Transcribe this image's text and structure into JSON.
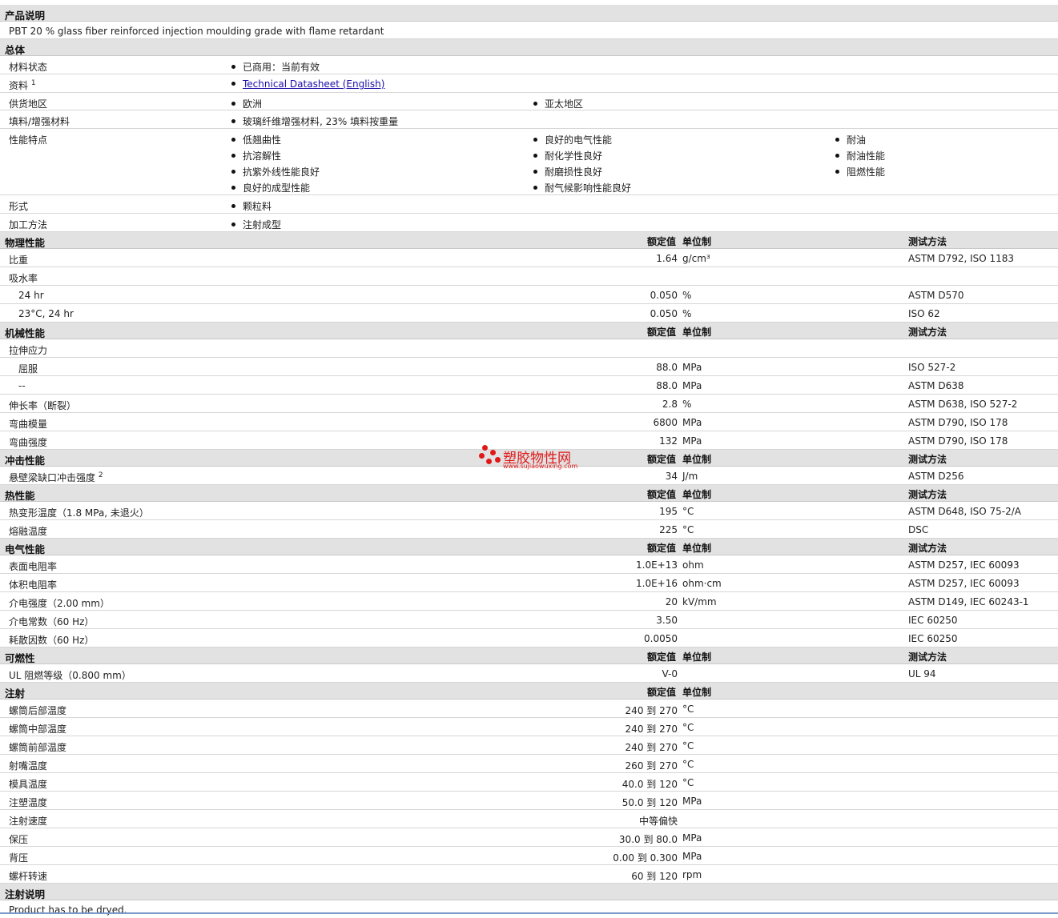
{
  "product": {
    "header": "产品说明",
    "description": "PBT 20 % glass fiber reinforced injection moulding grade with flame retardant"
  },
  "general": {
    "header": "总体",
    "rows": {
      "status": {
        "label": "材料状态",
        "items": [
          "已商用：当前有效"
        ]
      },
      "docs": {
        "label": "资料",
        "sup": "1",
        "link": "Technical Datasheet (English)"
      },
      "supply": {
        "label": "供货地区",
        "items": [
          "欧洲",
          "亚太地区"
        ]
      },
      "filler": {
        "label": "填料/增强材料",
        "items": [
          "玻璃纤维增强材料, 23% 填料按重量"
        ]
      },
      "features": {
        "label": "性能特点",
        "col1": [
          "低翘曲性",
          "抗溶解性",
          "抗紫外线性能良好",
          "良好的成型性能"
        ],
        "col2": [
          "良好的电气性能",
          "耐化学性良好",
          "耐磨损性良好",
          "耐气候影响性能良好"
        ],
        "col3": [
          "耐油",
          "耐油性能",
          "阻燃性能"
        ]
      },
      "form": {
        "label": "形式",
        "items": [
          "颗粒料"
        ]
      },
      "process": {
        "label": "加工方法",
        "items": [
          "注射成型"
        ]
      }
    }
  },
  "columns": {
    "value": "额定值",
    "unit": "单位制",
    "method": "测试方法"
  },
  "physical": {
    "header": "物理性能",
    "rows": [
      {
        "label": "比重",
        "value": "1.64",
        "unit": "g/cm³",
        "method": "ASTM D792, ISO 1183"
      },
      {
        "label": "吸水率",
        "value": "",
        "unit": "",
        "method": ""
      },
      {
        "label": "24 hr",
        "value": "0.050",
        "unit": "%",
        "method": "ASTM D570",
        "sub": true
      },
      {
        "label": "23°C, 24 hr",
        "value": "0.050",
        "unit": "%",
        "method": "ISO 62",
        "sub": true
      }
    ]
  },
  "mechanical": {
    "header": "机械性能",
    "rows": [
      {
        "label": "拉伸应力",
        "value": "",
        "unit": "",
        "method": ""
      },
      {
        "label": "屈服",
        "value": "88.0",
        "unit": "MPa",
        "method": "ISO 527-2",
        "sub": true
      },
      {
        "label": "--",
        "value": "88.0",
        "unit": "MPa",
        "method": "ASTM D638",
        "sub": true
      },
      {
        "label": "伸长率（断裂）",
        "value": "2.8",
        "unit": "%",
        "method": "ASTM D638, ISO 527-2"
      },
      {
        "label": "弯曲模量",
        "value": "6800",
        "unit": "MPa",
        "method": "ASTM D790, ISO 178"
      },
      {
        "label": "弯曲强度",
        "value": "132",
        "unit": "MPa",
        "method": "ASTM D790, ISO 178"
      }
    ]
  },
  "impact": {
    "header": "冲击性能",
    "rows": [
      {
        "label": "悬壁梁缺口冲击强度",
        "sup": "2",
        "value": "34",
        "unit": "J/m",
        "method": "ASTM D256"
      }
    ]
  },
  "thermal": {
    "header": "热性能",
    "rows": [
      {
        "label": "热变形温度（1.8 MPa, 未退火）",
        "value": "195",
        "unit": "°C",
        "method": "ASTM D648, ISO 75-2/A"
      },
      {
        "label": "熔融温度",
        "value": "225",
        "unit": "°C",
        "method": "DSC"
      }
    ]
  },
  "electrical": {
    "header": "电气性能",
    "rows": [
      {
        "label": "表面电阻率",
        "value": "1.0E+13",
        "unit": "ohm",
        "method": "ASTM D257, IEC 60093"
      },
      {
        "label": "体积电阻率",
        "value": "1.0E+16",
        "unit": "ohm·cm",
        "method": "ASTM D257, IEC 60093"
      },
      {
        "label": "介电强度（2.00 mm）",
        "value": "20",
        "unit": "kV/mm",
        "method": "ASTM D149, IEC 60243-1"
      },
      {
        "label": "介电常数（60 Hz）",
        "value": "3.50",
        "unit": "",
        "method": "IEC 60250"
      },
      {
        "label": "耗散因数（60 Hz）",
        "value": "0.0050",
        "unit": "",
        "method": "IEC 60250"
      }
    ]
  },
  "flammability": {
    "header": "可燃性",
    "rows": [
      {
        "label": "UL 阻燃等级（0.800 mm）",
        "value": "V-0",
        "unit": "",
        "method": "UL 94"
      }
    ]
  },
  "injection": {
    "header": "注射",
    "rows": [
      {
        "label": "螺筒后部温度",
        "value": "240 到  270",
        "unit": "°C"
      },
      {
        "label": "螺筒中部温度",
        "value": "240 到  270",
        "unit": "°C"
      },
      {
        "label": "螺筒前部温度",
        "value": "240 到  270",
        "unit": "°C"
      },
      {
        "label": "射嘴温度",
        "value": "260 到  270",
        "unit": "°C"
      },
      {
        "label": "模具温度",
        "value": "40.0 到  120",
        "unit": "°C"
      },
      {
        "label": "注塑温度",
        "value": "50.0 到  120",
        "unit": "MPa"
      },
      {
        "label": "注射速度",
        "value": "中等偏快",
        "unit": ""
      },
      {
        "label": "保压",
        "value": "30.0 到  80.0",
        "unit": "MPa"
      },
      {
        "label": "背压",
        "value": "0.00 到  0.300",
        "unit": "MPa"
      },
      {
        "label": "螺杆转速",
        "value": "60 到  120",
        "unit": "rpm"
      }
    ]
  },
  "injection_notes": {
    "header": "注射说明",
    "text": "Product has to be dryed."
  },
  "watermark": {
    "text": "塑胶物性网",
    "url": "www.sujiaowuxing.com",
    "color": "#e01818"
  }
}
